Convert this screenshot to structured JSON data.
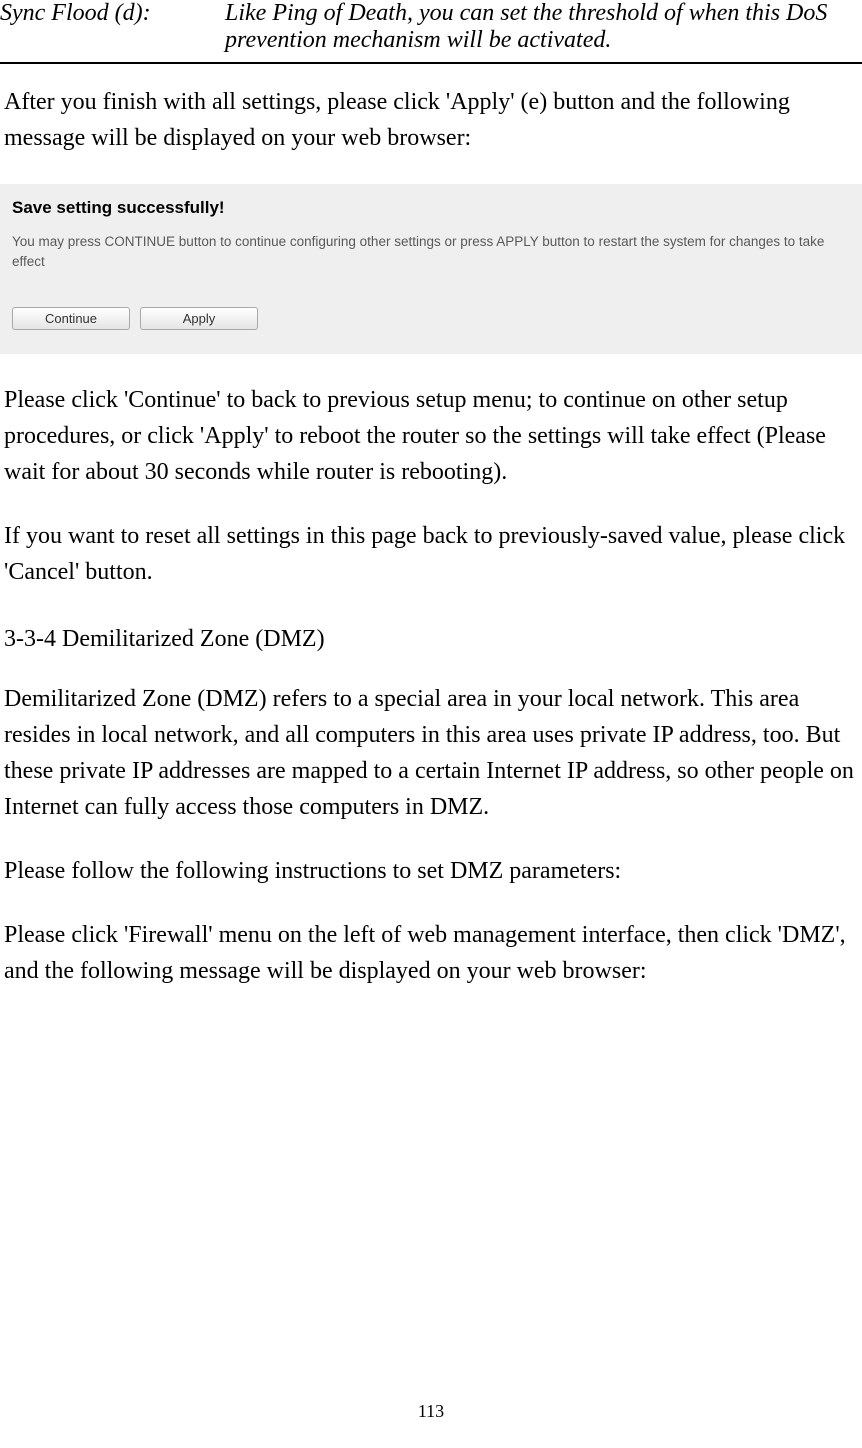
{
  "definition": {
    "term": "Sync Flood (d):",
    "desc": "Like Ping of Death, you can set the threshold of when this DoS prevention mechanism will be activated."
  },
  "para1": "After you finish with all settings, please click 'Apply' (e) button and the following message will be displayed on your web browser:",
  "screenshot": {
    "title": "Save setting successfully!",
    "text": "You may press CONTINUE button to continue configuring other settings or press APPLY button to restart the system for changes to take effect",
    "continue_label": "Continue",
    "apply_label": "Apply"
  },
  "para2": "Please click 'Continue' to back to previous setup menu; to continue on other setup procedures, or click 'Apply' to reboot the router so the settings will take effect (Please wait for about 30 seconds while router is rebooting).",
  "para3": "If you want to reset all settings in this page back to previously-saved value, please click 'Cancel' button.",
  "heading": "3-3-4 Demilitarized Zone (DMZ)",
  "para4": "Demilitarized Zone (DMZ) refers to a special area in your local network. This area resides in local network, and all computers in this area uses private IP address, too. But these private IP addresses are mapped to a certain Internet IP address, so other people on Internet can fully access those computers in DMZ.",
  "para5": "Please follow the following instructions to set DMZ parameters:",
  "para6": "Please click 'Firewall' menu on the left of web management interface, then click 'DMZ', and the following message will be displayed on your web browser:",
  "page_number": "113"
}
